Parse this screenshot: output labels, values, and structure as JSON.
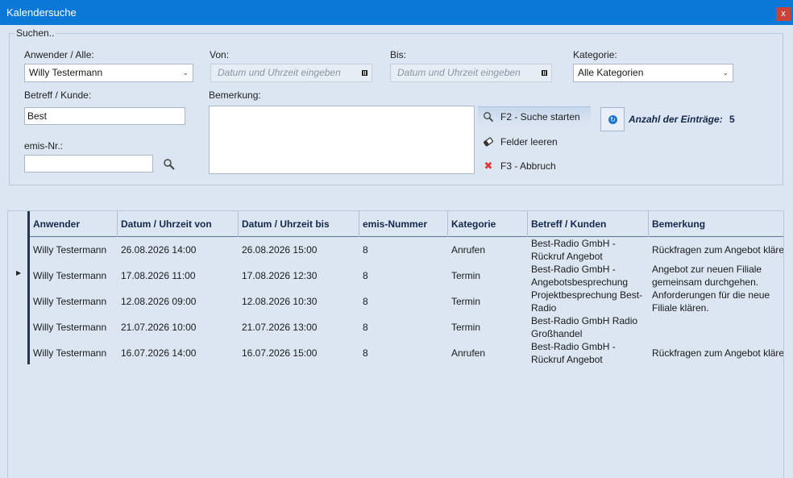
{
  "window": {
    "title": "Kalendersuche",
    "close_label": "x"
  },
  "search": {
    "legend": "Suchen..",
    "user_label": "Anwender / Alle:",
    "user_value": "Willy Testermann",
    "from_label": "Von:",
    "from_placeholder": "Datum und Uhrzeit eingeben",
    "to_label": "Bis:",
    "to_placeholder": "Datum und Uhrzeit eingeben",
    "category_label": "Kategorie:",
    "category_value": "Alle Kategorien",
    "subject_label": "Betreff / Kunde:",
    "subject_value": "Best",
    "remark_label": "Bemerkung:",
    "remark_value": "",
    "emis_label": "emis-Nr.:",
    "emis_value": ""
  },
  "actions": {
    "start_search": "F2 - Suche starten",
    "clear_fields": "Felder leeren",
    "cancel": "F3 - Abbruch"
  },
  "summary": {
    "count_label": "Anzahl der Einträge:",
    "count_value": "5"
  },
  "table": {
    "columns": [
      "Anwender",
      "Datum / Uhrzeit von",
      "Datum / Uhrzeit bis",
      "emis-Nummer",
      "Kategorie",
      "Betreff / Kunden",
      "Bemerkung"
    ],
    "rows": [
      {
        "user": "Willy Testermann",
        "from": "26.08.2026 14:00",
        "to": "26.08.2026 15:00",
        "emis": "8",
        "category": "Anrufen",
        "subject": "Best-Radio GmbH - Rückruf Angebot",
        "remark": "Rückfragen zum Angebot kläre"
      },
      {
        "user": "Willy Testermann",
        "from": "17.08.2026 11:00",
        "to": "17.08.2026 12:30",
        "emis": "8",
        "category": "Termin",
        "subject": "Best-Radio GmbH - Angebotsbesprechung",
        "remark": "Angebot zur neuen Filiale gemeinsam durchgehen."
      },
      {
        "user": "Willy Testermann",
        "from": "12.08.2026 09:00",
        "to": "12.08.2026 10:30",
        "emis": "8",
        "category": "Termin",
        "subject": "Projektbesprechung Best-Radio",
        "remark": "Anforderungen für die neue Filiale klären."
      },
      {
        "user": "Willy Testermann",
        "from": "21.07.2026 10:00",
        "to": "21.07.2026 13:00",
        "emis": "8",
        "category": "Termin",
        "subject": "Best-Radio GmbH Radio Großhandel",
        "remark": ""
      },
      {
        "user": "Willy Testermann",
        "from": "16.07.2026 14:00",
        "to": "16.07.2026 15:00",
        "emis": "8",
        "category": "Anrufen",
        "subject": "Best-Radio GmbH - Rückruf Angebot",
        "remark": "Rückfragen zum Angebot kläre"
      }
    ]
  }
}
